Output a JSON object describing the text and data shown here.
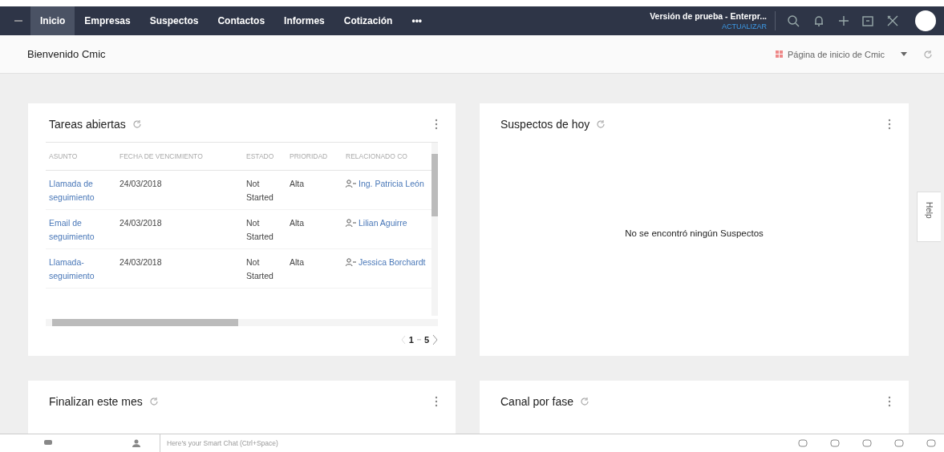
{
  "topbar": {
    "tabs": [
      {
        "label": "Inicio",
        "selected": true
      },
      {
        "label": "Empresas",
        "selected": false
      },
      {
        "label": "Suspectos",
        "selected": false
      },
      {
        "label": "Contactos",
        "selected": false
      },
      {
        "label": "Informes",
        "selected": false
      },
      {
        "label": "Cotización",
        "selected": false
      },
      {
        "label": "•••",
        "selected": false
      }
    ],
    "trial": "Versión de prueba - Enterpr...",
    "upgrade": "ACTUALIZAR"
  },
  "header": {
    "title": "Bienvenido Cmic",
    "page_selector": "Página de inicio de Cmic"
  },
  "cards": [
    {
      "title": "Tareas abiertas",
      "kind": "table",
      "table": {
        "columns": [
          "ASUNTO",
          "FECHA DE VENCIMIENTO",
          "ESTADO",
          "PRIORIDAD",
          "RELACIONADO CO"
        ],
        "rows": [
          {
            "subject": "Llamada de seguimiento",
            "due": "24/03/2018",
            "status": "Not Started",
            "priority": "Alta",
            "related": "Ing. Patricia León"
          },
          {
            "subject": "Email de seguimiento",
            "due": "24/03/2018",
            "status": "Not Started",
            "priority": "Alta",
            "related": "Lilian Aguirre"
          },
          {
            "subject": "Llamada-seguimiento",
            "due": "24/03/2018",
            "status": "Not Started",
            "priority": "Alta",
            "related": "Jessica Borchardt"
          }
        ],
        "pagination": {
          "from": "1",
          "to": "5"
        }
      }
    },
    {
      "title": "Suspectos de hoy",
      "kind": "empty",
      "message": "No se encontró ningún Suspectos"
    },
    {
      "title": "Finalizan este mes",
      "kind": "cut"
    },
    {
      "title": "Canal por fase",
      "kind": "cut"
    }
  ],
  "side_tab": "Help",
  "chat_bar": {
    "placeholder": "Here's your Smart Chat (Ctrl+Space)"
  }
}
